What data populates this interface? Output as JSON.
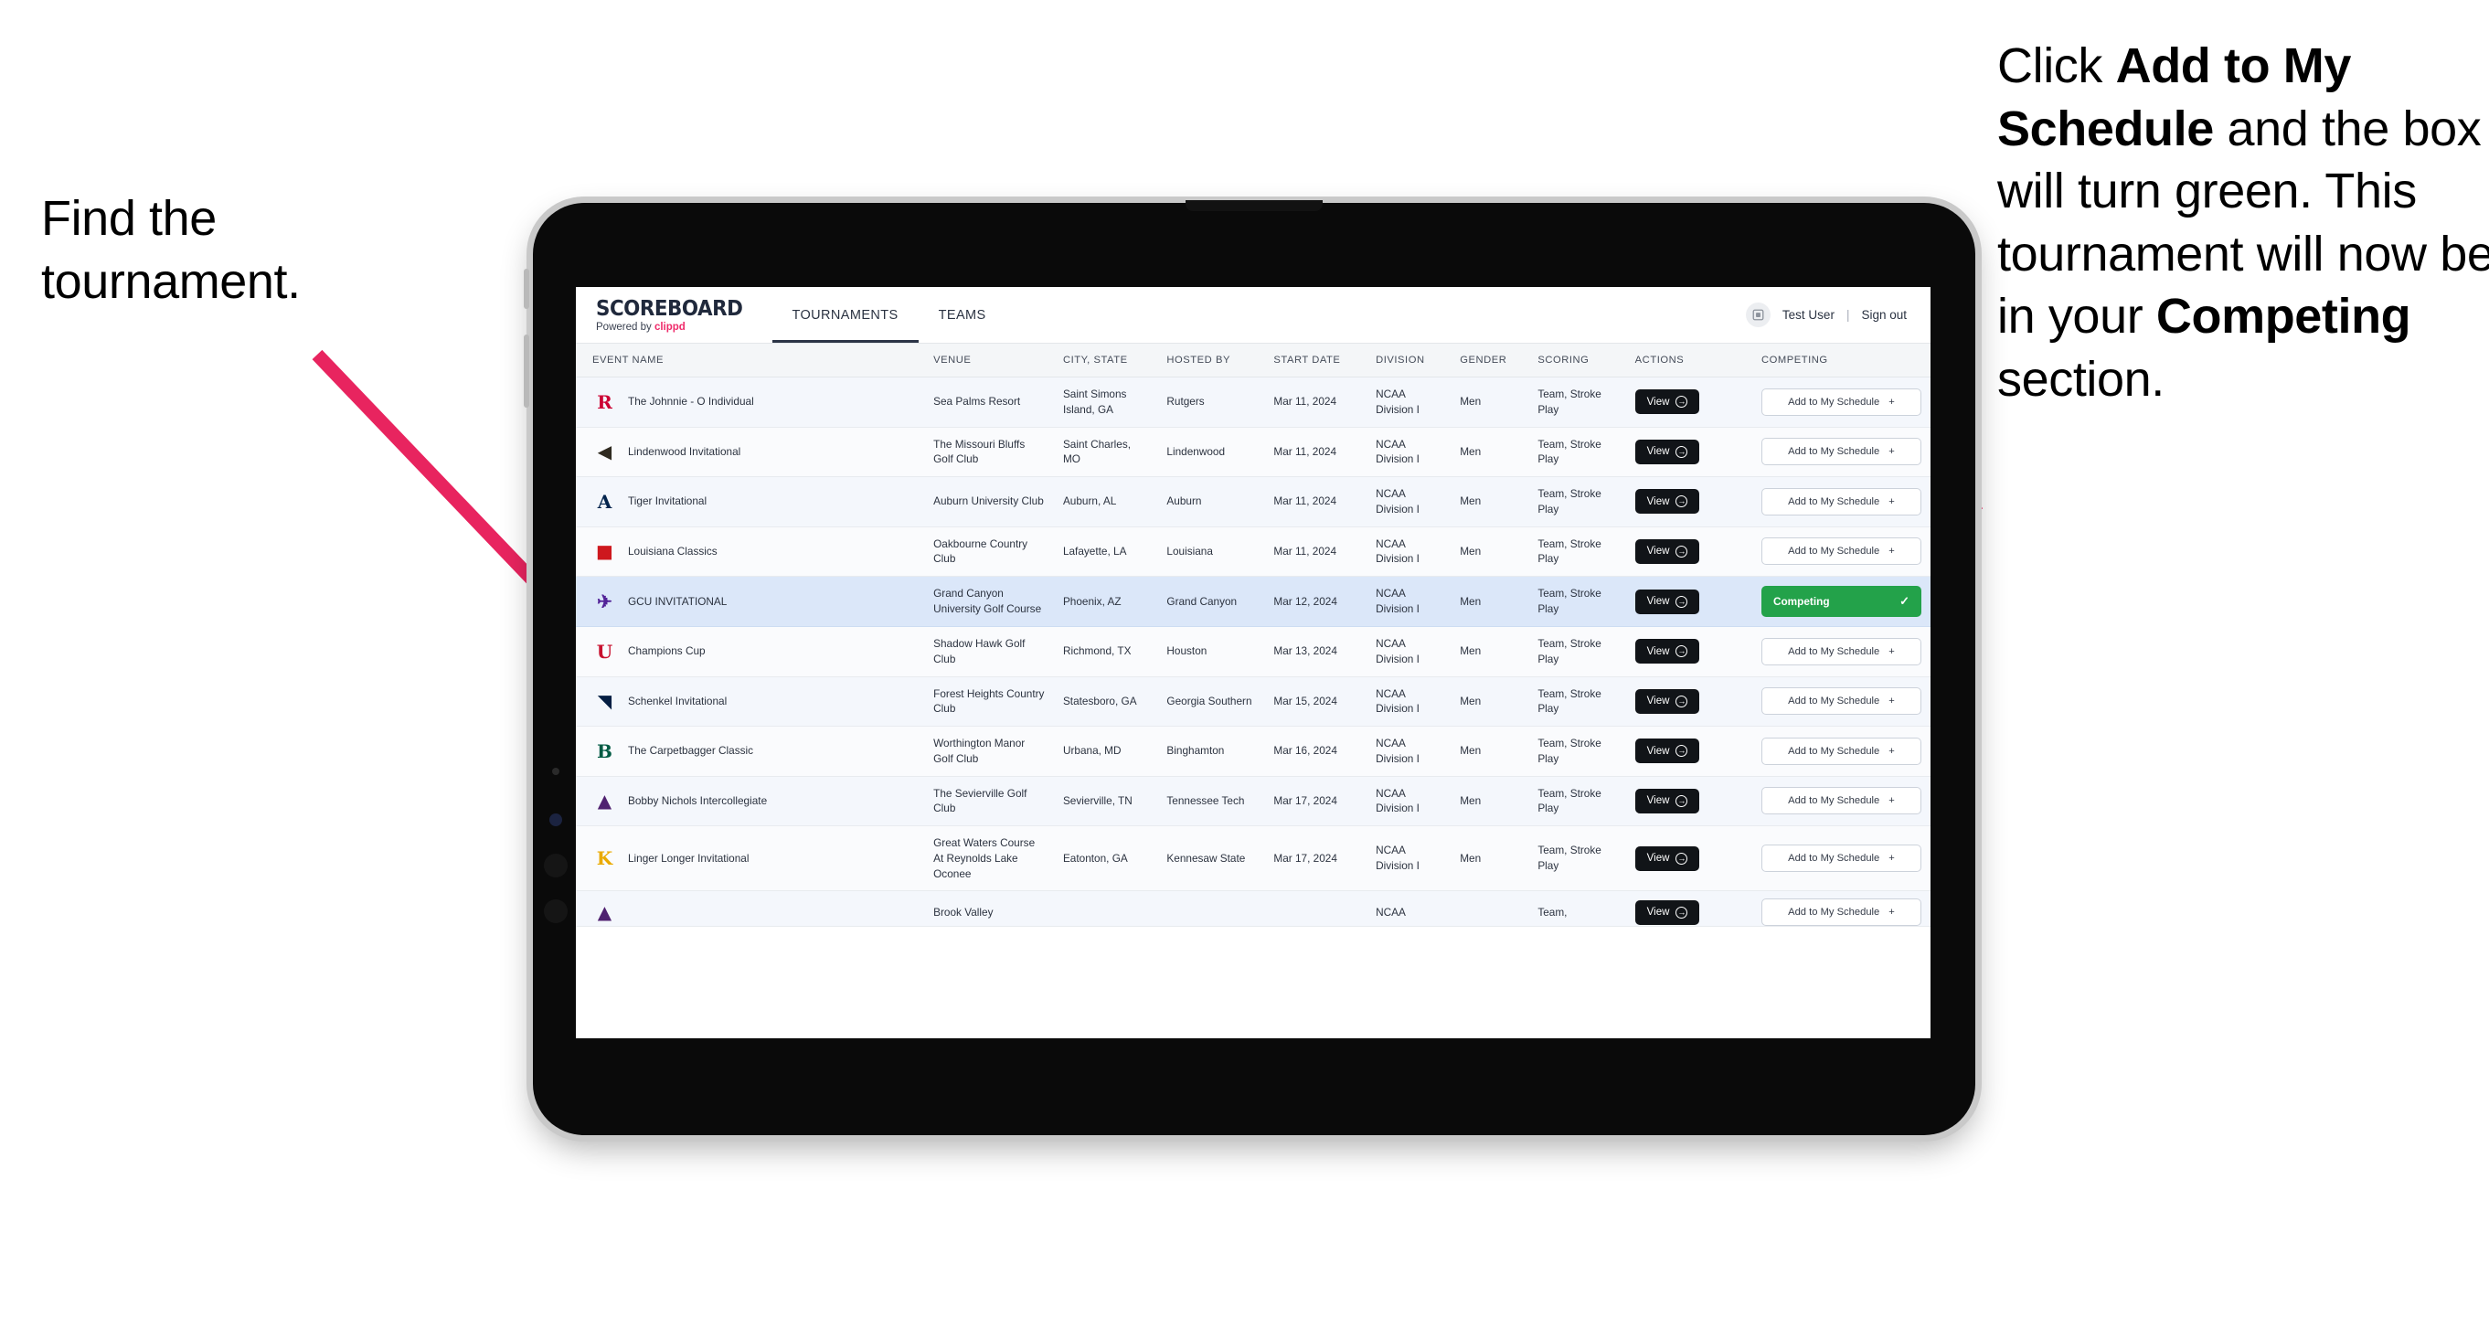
{
  "annotations": {
    "left": {
      "line1": "Find the",
      "line2": "tournament."
    },
    "right": {
      "p1_pre": "Click ",
      "p1_bold": "Add to My Schedule",
      "p1_post": " and the box will turn green. This tournament will now be in your ",
      "p2_bold": "Competing",
      "p2_post": " section."
    },
    "arrow_color": "#e8245f"
  },
  "app": {
    "brand": {
      "title": "SCOREBOARD",
      "powered_prefix": "Powered by ",
      "powered_brand": "clippd"
    },
    "nav": [
      {
        "label": "TOURNAMENTS",
        "active": true
      },
      {
        "label": "TEAMS",
        "active": false
      }
    ],
    "user": {
      "name": "Test User",
      "separator": "|",
      "signout": "Sign out"
    },
    "table": {
      "columns": [
        "EVENT NAME",
        "VENUE",
        "CITY, STATE",
        "HOSTED BY",
        "START DATE",
        "DIVISION",
        "GENDER",
        "SCORING",
        "ACTIONS",
        "COMPETING"
      ],
      "view_label": "View",
      "add_label": "Add to My Schedule",
      "add_plus": "+",
      "competing_label": "Competing",
      "rows": [
        {
          "event": "The Johnnie - O Individual",
          "venue": "Sea Palms Resort",
          "city": "Saint Simons Island, GA",
          "host": "Rutgers",
          "date": "Mar 11, 2024",
          "division": "NCAA Division I",
          "gender": "Men",
          "scoring": "Team, Stroke Play",
          "competing": false,
          "logo": {
            "glyph": "R",
            "color": "#cc0033"
          }
        },
        {
          "event": "Lindenwood Invitational",
          "venue": "The Missouri Bluffs Golf Club",
          "city": "Saint Charles, MO",
          "host": "Lindenwood",
          "date": "Mar 11, 2024",
          "division": "NCAA Division I",
          "gender": "Men",
          "scoring": "Team, Stroke Play",
          "competing": false,
          "logo": {
            "glyph": "◀",
            "color": "#2f2a20"
          }
        },
        {
          "event": "Tiger Invitational",
          "venue": "Auburn University Club",
          "city": "Auburn, AL",
          "host": "Auburn",
          "date": "Mar 11, 2024",
          "division": "NCAA Division I",
          "gender": "Men",
          "scoring": "Team, Stroke Play",
          "competing": false,
          "logo": {
            "glyph": "A",
            "color": "#03244d"
          }
        },
        {
          "event": "Louisiana Classics",
          "venue": "Oakbourne Country Club",
          "city": "Lafayette, LA",
          "host": "Louisiana",
          "date": "Mar 11, 2024",
          "division": "NCAA Division I",
          "gender": "Men",
          "scoring": "Team, Stroke Play",
          "competing": false,
          "logo": {
            "glyph": "■",
            "color": "#ce181e"
          }
        },
        {
          "event": "GCU INVITATIONAL",
          "venue": "Grand Canyon University Golf Course",
          "city": "Phoenix, AZ",
          "host": "Grand Canyon",
          "date": "Mar 12, 2024",
          "division": "NCAA Division I",
          "gender": "Men",
          "scoring": "Team, Stroke Play",
          "competing": true,
          "logo": {
            "glyph": "✈",
            "color": "#522398"
          }
        },
        {
          "event": "Champions Cup",
          "venue": "Shadow Hawk Golf Club",
          "city": "Richmond, TX",
          "host": "Houston",
          "date": "Mar 13, 2024",
          "division": "NCAA Division I",
          "gender": "Men",
          "scoring": "Team, Stroke Play",
          "competing": false,
          "logo": {
            "glyph": "U",
            "color": "#c8102e"
          }
        },
        {
          "event": "Schenkel Invitational",
          "venue": "Forest Heights Country Club",
          "city": "Statesboro, GA",
          "host": "Georgia Southern",
          "date": "Mar 15, 2024",
          "division": "NCAA Division I",
          "gender": "Men",
          "scoring": "Team, Stroke Play",
          "competing": false,
          "logo": {
            "glyph": "◥",
            "color": "#041e42"
          }
        },
        {
          "event": "The Carpetbagger Classic",
          "venue": "Worthington Manor Golf Club",
          "city": "Urbana, MD",
          "host": "Binghamton",
          "date": "Mar 16, 2024",
          "division": "NCAA Division I",
          "gender": "Men",
          "scoring": "Team, Stroke Play",
          "competing": false,
          "logo": {
            "glyph": "B",
            "color": "#005a43"
          }
        },
        {
          "event": "Bobby Nichols Intercollegiate",
          "venue": "The Sevierville Golf Club",
          "city": "Sevierville, TN",
          "host": "Tennessee Tech",
          "date": "Mar 17, 2024",
          "division": "NCAA Division I",
          "gender": "Men",
          "scoring": "Team, Stroke Play",
          "competing": false,
          "logo": {
            "glyph": "▲",
            "color": "#4f2170"
          }
        },
        {
          "event": "Linger Longer Invitational",
          "venue": "Great Waters Course At Reynolds Lake Oconee",
          "city": "Eatonton, GA",
          "host": "Kennesaw State",
          "date": "Mar 17, 2024",
          "division": "NCAA Division I",
          "gender": "Men",
          "scoring": "Team, Stroke Play",
          "competing": false,
          "logo": {
            "glyph": "K",
            "color": "#eaaa00"
          }
        },
        {
          "event": "",
          "venue": "Brook Valley",
          "city": "",
          "host": "",
          "date": "",
          "division": "NCAA",
          "gender": "",
          "scoring": "Team,",
          "competing": false,
          "cut": true,
          "logo": {
            "glyph": "▲",
            "color": "#4f2170"
          }
        }
      ]
    }
  }
}
